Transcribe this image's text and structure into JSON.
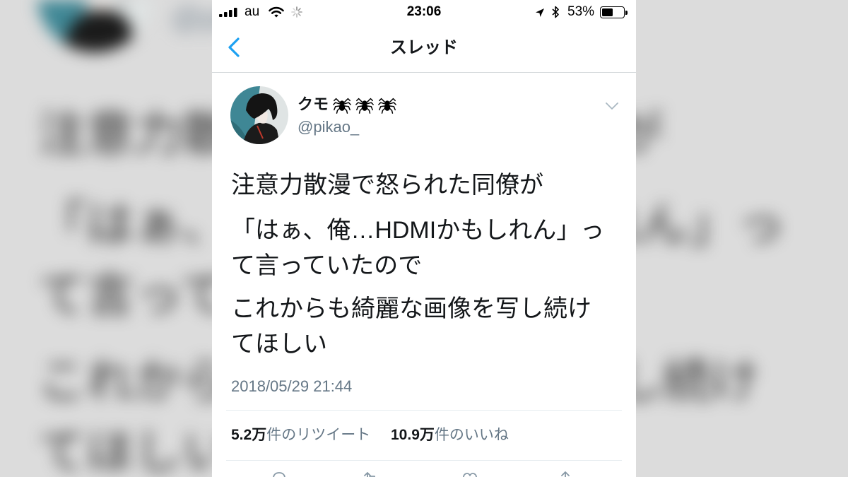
{
  "status_bar": {
    "carrier": "au",
    "signal_bars": 4,
    "time": "23:06",
    "battery_percent": "53%",
    "battery_level": 0.53,
    "icons": [
      "signal-bars-icon",
      "wifi-icon",
      "activity-spinner-icon",
      "location-arrow-icon",
      "bluetooth-icon",
      "battery-icon"
    ]
  },
  "nav": {
    "back_icon": "chevron-left-icon",
    "title": "スレッド"
  },
  "tweet": {
    "author_name": "クモ",
    "name_emoji": [
      "spider-icon",
      "spider-icon",
      "spider-icon"
    ],
    "handle": "@pikao_",
    "menu_icon": "chevron-down-icon",
    "paragraphs": [
      [
        "注意力散漫で怒られた同僚が"
      ],
      [
        "「はぁ、俺…HDMIかもしれん」っ",
        "て言っていたので"
      ],
      [
        "これからも綺麗な画像を写し続け",
        "てほしい"
      ]
    ],
    "timestamp": "2018/05/29 21:44",
    "stats": {
      "retweets": {
        "count": "5.2万",
        "label": "件のリツイート"
      },
      "likes": {
        "count": "10.9万",
        "label": "件のいいね"
      }
    },
    "actions": [
      "reply-icon",
      "retweet-icon",
      "like-icon",
      "share-icon"
    ]
  },
  "colors": {
    "accent": "#1da1f2",
    "primary_text": "#14171a",
    "secondary_text": "#657786",
    "divider": "#e6ecf0"
  }
}
